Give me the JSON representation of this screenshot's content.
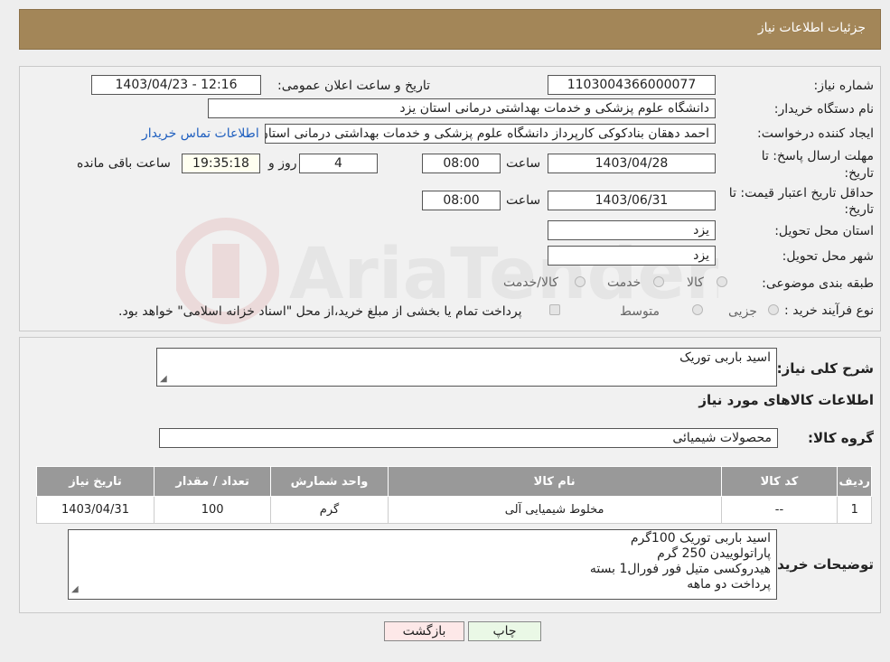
{
  "header": {
    "title": "جزئیات اطلاعات نیاز"
  },
  "watermark": {
    "text": "AriaTender.neT"
  },
  "form": {
    "need_number_label": "شماره نیاز:",
    "need_number": "1103004366000077",
    "announce_label": "تاریخ و ساعت اعلان عمومی:",
    "announce_value": "1403/04/23 - 12:16",
    "buyer_org_label": "نام دستگاه خریدار:",
    "buyer_org": "دانشگاه علوم پزشکی و خدمات بهداشتی  درمانی استان یزد",
    "requester_label": "ایجاد کننده درخواست:",
    "requester": "احمد دهقان بنادکوکی کارپرداز دانشگاه علوم پزشکی و خدمات بهداشتی  درمانی استان یزد",
    "contact_link": "اطلاعات تماس خریدار",
    "deadline_label_1": "مهلت ارسال پاسخ: تا",
    "deadline_label_2": "تاریخ:",
    "deadline_date": "1403/04/28",
    "time_label": "ساعت",
    "deadline_time": "08:00",
    "days_value": "4",
    "days_label": "روز و",
    "remaining_time": "19:35:18",
    "remaining_label": "ساعت باقی مانده",
    "validity_label_1": "حداقل تاریخ اعتبار قیمت: تا",
    "validity_label_2": "تاریخ:",
    "validity_date": "1403/06/31",
    "validity_time": "08:00",
    "province_label": "استان محل تحویل:",
    "province": "یزد",
    "city_label": "شهر محل تحویل:",
    "city": "یزد",
    "category_label": "طبقه بندی موضوعی:",
    "category_options": [
      "کالا",
      "خدمت",
      "کالا/خدمت"
    ],
    "process_label": "نوع فرآیند خرید :",
    "process_options": [
      "جزیی",
      "متوسط"
    ],
    "payment_note": "پرداخت تمام یا بخشی از مبلغ خرید،از محل \"اسناد خزانه اسلامی\" خواهد بود."
  },
  "summary": {
    "description_label": "شرح کلی نیاز:",
    "description": "اسید باربی توریک",
    "goods_info_title": "اطلاعات کالاهای مورد نیاز",
    "goods_group_label": "گروه کالا:",
    "goods_group": "محصولات شیمیائی"
  },
  "table": {
    "headers": [
      "ردیف",
      "کد کالا",
      "نام کالا",
      "واحد شمارش",
      "تعداد / مقدار",
      "تاریخ نیاز"
    ],
    "rows": [
      [
        "1",
        "--",
        "مخلوط شیمیایی آلی",
        "گرم",
        "100",
        "1403/04/31"
      ]
    ]
  },
  "buyer_notes": {
    "label": "توضیحات خریدار:",
    "lines": [
      "اسید باربی توریک 100گرم",
      "پاراتولوییدن 250 گرم",
      "هیدروکسی متیل فور فورال1 بسته",
      "پرداخت دو ماهه"
    ]
  },
  "buttons": {
    "print": "چاپ",
    "back": "بازگشت"
  },
  "colors": {
    "header_bg": "#a38658",
    "table_header_bg": "#999999",
    "link": "#1f5fbf",
    "back_button_bg": "#fde8e8",
    "print_button_bg": "#eaf8e6"
  }
}
